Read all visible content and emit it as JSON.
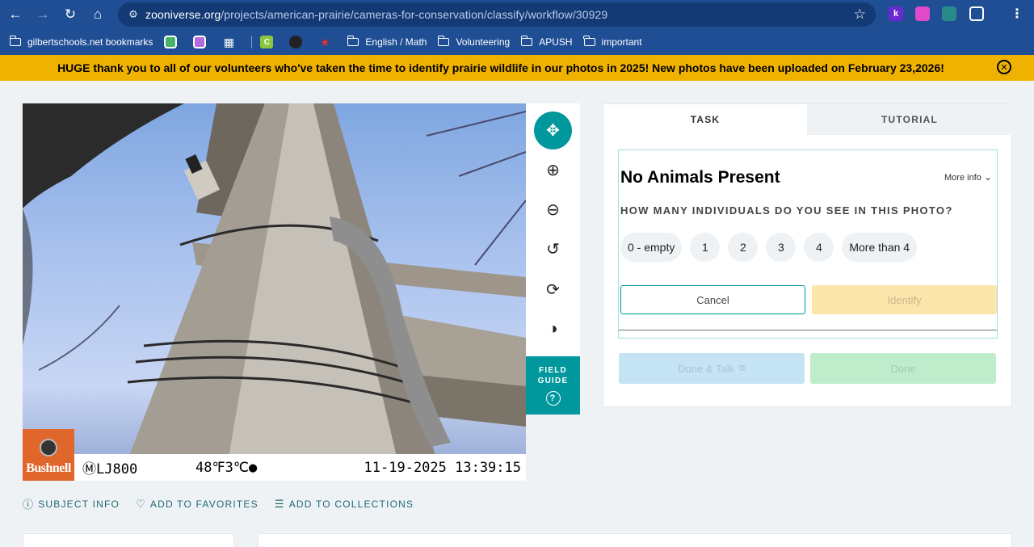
{
  "browser": {
    "url_domain": "zooniverse.org",
    "url_path": "/projects/american-prairie/cameras-for-conservation/classify/workflow/30929",
    "bookmarks": [
      {
        "label": "gilbertschools.net bookmarks",
        "type": "folder-special"
      },
      {
        "label": "English / Math",
        "type": "folder"
      },
      {
        "label": "Volunteering",
        "type": "folder"
      },
      {
        "label": "APUSH",
        "type": "folder"
      },
      {
        "label": "important",
        "type": "folder"
      }
    ],
    "extensions": [
      "k",
      "video",
      "puzzle"
    ]
  },
  "announcement": {
    "text": "HUGE thank you to all of our volunteers who've taken the time to identify prairie wildlife in our photos in 2025! New photos have been uploaded on February 23,2026!"
  },
  "camera_overlay": {
    "brand": "Bushnell",
    "model": "ⓂLJ800",
    "temperature": "48℉3℃●",
    "timestamp": "11-19-2025 13:39:15"
  },
  "tools": [
    "move-icon",
    "zoom-in-icon",
    "zoom-out-icon",
    "rotate-icon",
    "reset-icon",
    "invert-icon"
  ],
  "field_guide": {
    "line1": "FIELD",
    "line2": "GUIDE",
    "icon": "?"
  },
  "tabs": {
    "task": "TASK",
    "tutorial": "TUTORIAL"
  },
  "task": {
    "title": "No Animals Present",
    "more_info": "More info",
    "question": "HOW MANY INDIVIDUALS DO YOU SEE IN THIS PHOTO?",
    "answers": [
      "0 - empty",
      "1",
      "2",
      "3",
      "4",
      "More than 4"
    ],
    "cancel": "Cancel",
    "identify": "Identify"
  },
  "buttons": {
    "done_talk": "Done & Talk",
    "done": "Done"
  },
  "subject_actions": {
    "info": "SUBJECT INFO",
    "favorites": "ADD TO FAVORITES",
    "collections": "ADD TO COLLECTIONS"
  },
  "colors": {
    "accent": "#00979d",
    "announcement": "#f0b200",
    "chrome": "#1f4e95"
  }
}
